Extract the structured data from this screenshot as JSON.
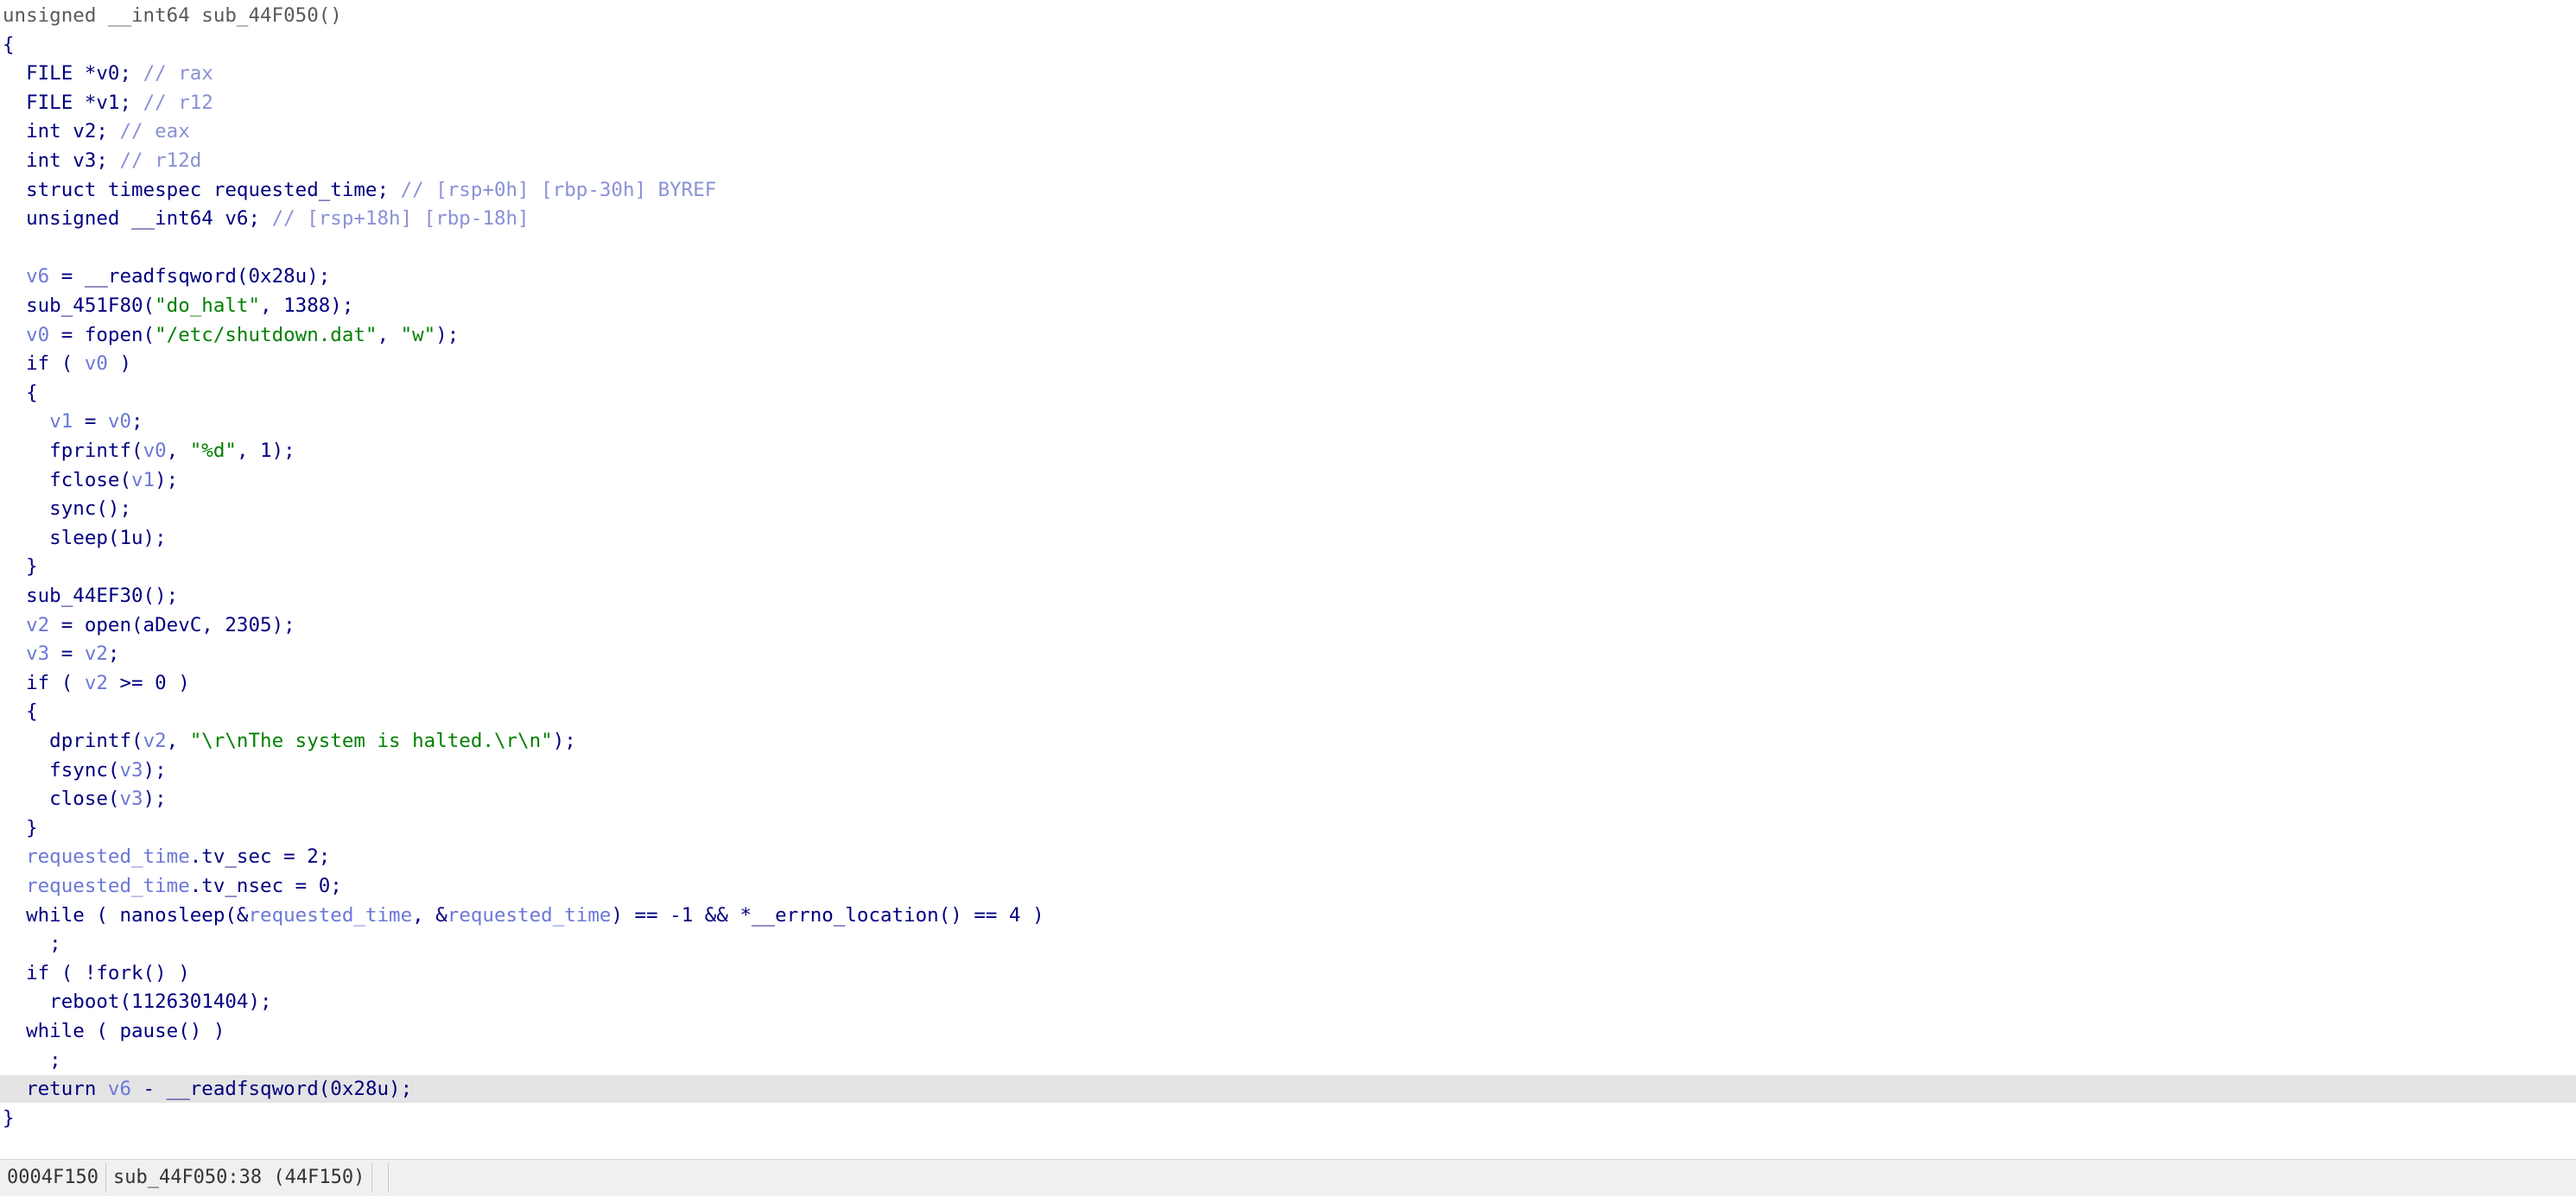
{
  "code": {
    "lines": [
      [
        {
          "t": "unsigned __int64 sub_44F050()",
          "c": "sig"
        }
      ],
      [
        {
          "t": "{",
          "c": "punct"
        }
      ],
      [
        {
          "t": "  FILE *v0; ",
          "c": "kw"
        },
        {
          "t": "// rax",
          "c": "cmt"
        }
      ],
      [
        {
          "t": "  FILE *v1; ",
          "c": "kw"
        },
        {
          "t": "// r12",
          "c": "cmt"
        }
      ],
      [
        {
          "t": "  int v2; ",
          "c": "kw"
        },
        {
          "t": "// eax",
          "c": "cmt"
        }
      ],
      [
        {
          "t": "  int v3; ",
          "c": "kw"
        },
        {
          "t": "// r12d",
          "c": "cmt"
        }
      ],
      [
        {
          "t": "  struct timespec requested_time; ",
          "c": "kw"
        },
        {
          "t": "// [rsp+0h] [rbp-30h] BYREF",
          "c": "cmt"
        }
      ],
      [
        {
          "t": "  unsigned __int64 v6; ",
          "c": "kw"
        },
        {
          "t": "// [rsp+18h] [rbp-18h]",
          "c": "cmt"
        }
      ],
      [
        {
          "t": "",
          "c": "kw"
        }
      ],
      [
        {
          "t": "  ",
          "c": "kw"
        },
        {
          "t": "v6",
          "c": "var"
        },
        {
          "t": " = __readfsqword(0x28u);",
          "c": "fn"
        }
      ],
      [
        {
          "t": "  sub_451F80(",
          "c": "fn"
        },
        {
          "t": "\"do_halt\"",
          "c": "str"
        },
        {
          "t": ", 1388);",
          "c": "fn"
        }
      ],
      [
        {
          "t": "  ",
          "c": "kw"
        },
        {
          "t": "v0",
          "c": "var"
        },
        {
          "t": " = fopen(",
          "c": "fn"
        },
        {
          "t": "\"/etc/shutdown.dat\"",
          "c": "str"
        },
        {
          "t": ", ",
          "c": "fn"
        },
        {
          "t": "\"w\"",
          "c": "str"
        },
        {
          "t": ");",
          "c": "fn"
        }
      ],
      [
        {
          "t": "  if ( ",
          "c": "kw"
        },
        {
          "t": "v0",
          "c": "var"
        },
        {
          "t": " )",
          "c": "kw"
        }
      ],
      [
        {
          "t": "  {",
          "c": "punct"
        }
      ],
      [
        {
          "t": "    ",
          "c": "kw"
        },
        {
          "t": "v1",
          "c": "var"
        },
        {
          "t": " = ",
          "c": "kw"
        },
        {
          "t": "v0",
          "c": "var"
        },
        {
          "t": ";",
          "c": "kw"
        }
      ],
      [
        {
          "t": "    fprintf(",
          "c": "fn"
        },
        {
          "t": "v0",
          "c": "var"
        },
        {
          "t": ", ",
          "c": "fn"
        },
        {
          "t": "\"%d\"",
          "c": "str"
        },
        {
          "t": ", 1);",
          "c": "fn"
        }
      ],
      [
        {
          "t": "    fclose(",
          "c": "fn"
        },
        {
          "t": "v1",
          "c": "var"
        },
        {
          "t": ");",
          "c": "fn"
        }
      ],
      [
        {
          "t": "    sync();",
          "c": "fn"
        }
      ],
      [
        {
          "t": "    sleep(1u);",
          "c": "fn"
        }
      ],
      [
        {
          "t": "  }",
          "c": "punct"
        }
      ],
      [
        {
          "t": "  sub_44EF30();",
          "c": "fn"
        }
      ],
      [
        {
          "t": "  ",
          "c": "kw"
        },
        {
          "t": "v2",
          "c": "var"
        },
        {
          "t": " = open(aDevC, 2305);",
          "c": "fn"
        }
      ],
      [
        {
          "t": "  ",
          "c": "kw"
        },
        {
          "t": "v3",
          "c": "var"
        },
        {
          "t": " = ",
          "c": "kw"
        },
        {
          "t": "v2",
          "c": "var"
        },
        {
          "t": ";",
          "c": "kw"
        }
      ],
      [
        {
          "t": "  if ( ",
          "c": "kw"
        },
        {
          "t": "v2",
          "c": "var"
        },
        {
          "t": " >= 0 )",
          "c": "kw"
        }
      ],
      [
        {
          "t": "  {",
          "c": "punct"
        }
      ],
      [
        {
          "t": "    dprintf(",
          "c": "fn"
        },
        {
          "t": "v2",
          "c": "var"
        },
        {
          "t": ", ",
          "c": "fn"
        },
        {
          "t": "\"\\r\\nThe system is halted.\\r\\n\"",
          "c": "str"
        },
        {
          "t": ");",
          "c": "fn"
        }
      ],
      [
        {
          "t": "    fsync(",
          "c": "fn"
        },
        {
          "t": "v3",
          "c": "var"
        },
        {
          "t": ");",
          "c": "fn"
        }
      ],
      [
        {
          "t": "    close(",
          "c": "fn"
        },
        {
          "t": "v3",
          "c": "var"
        },
        {
          "t": ");",
          "c": "fn"
        }
      ],
      [
        {
          "t": "  }",
          "c": "punct"
        }
      ],
      [
        {
          "t": "  ",
          "c": "kw"
        },
        {
          "t": "requested_time",
          "c": "var"
        },
        {
          "t": ".tv_sec = 2;",
          "c": "kw"
        }
      ],
      [
        {
          "t": "  ",
          "c": "kw"
        },
        {
          "t": "requested_time",
          "c": "var"
        },
        {
          "t": ".tv_nsec = 0;",
          "c": "kw"
        }
      ],
      [
        {
          "t": "  while ( nanosleep(&",
          "c": "kw"
        },
        {
          "t": "requested_time",
          "c": "var"
        },
        {
          "t": ", &",
          "c": "kw"
        },
        {
          "t": "requested_time",
          "c": "var"
        },
        {
          "t": ") == -1 && *__errno_location() == 4 )",
          "c": "kw"
        }
      ],
      [
        {
          "t": "    ;",
          "c": "kw"
        }
      ],
      [
        {
          "t": "  if ( !fork() )",
          "c": "kw"
        }
      ],
      [
        {
          "t": "    reboot(1126301404);",
          "c": "fn"
        }
      ],
      [
        {
          "t": "  while ( pause() )",
          "c": "kw"
        }
      ],
      [
        {
          "t": "    ;",
          "c": "kw"
        }
      ],
      [
        {
          "t": "  return ",
          "c": "kw"
        },
        {
          "t": "v6",
          "c": "var"
        },
        {
          "t": " - __readfsqword(0x28u);",
          "c": "fn"
        }
      ],
      [
        {
          "t": "}",
          "c": "punct"
        }
      ]
    ],
    "current_line_index": 37,
    "colors": {
      "keyword": "#000080",
      "variable": "#6b78d6",
      "string": "#008000",
      "comment": "#8a91d6",
      "current_line_bg": "#e4e4e4"
    }
  },
  "status_bar": {
    "offset": "0004F150",
    "location": "sub_44F050:38 (44F150)"
  }
}
